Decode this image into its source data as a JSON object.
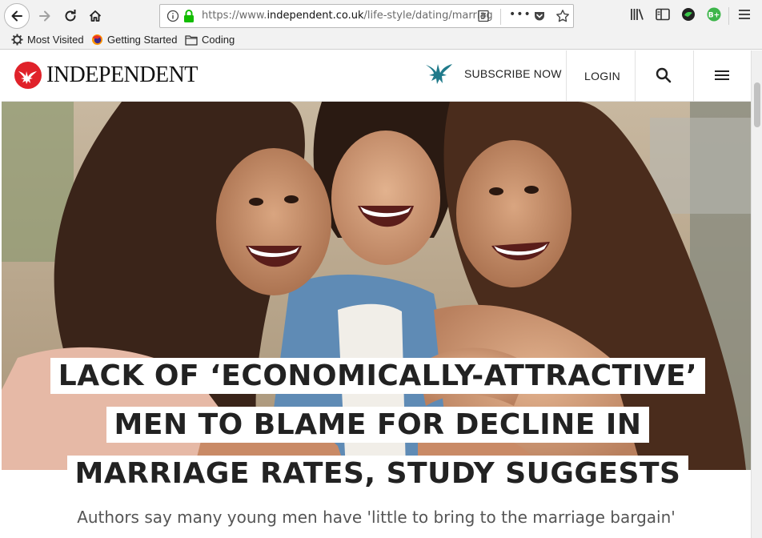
{
  "browser": {
    "url_prefix": "https://www.",
    "url_domain": "independent.co.uk",
    "url_path": "/life-style/dating/marriag",
    "bookmarks": [
      {
        "label": "Most Visited",
        "icon": "gear-icon"
      },
      {
        "label": "Getting Started",
        "icon": "firefox-icon"
      },
      {
        "label": "Coding",
        "icon": "folder-icon"
      }
    ],
    "extension_badge": "B+"
  },
  "site": {
    "logo_text": "INDEPENDENT",
    "subscribe_label": "SUBSCRIBE NOW",
    "login_label": "LOGIN"
  },
  "article": {
    "headline": "LACK OF ‘ECONOMICALLY-ATTRACTIVE’ MEN TO BLAME FOR DECLINE IN MARRIAGE RATES, STUDY SUGGESTS",
    "standfirst": "Authors say many young men have 'little to bring to the marriage bargain'"
  },
  "colors": {
    "brand_red": "#e0222a",
    "lock_green": "#12bc00",
    "chrome_bg": "#f2f2f2"
  }
}
